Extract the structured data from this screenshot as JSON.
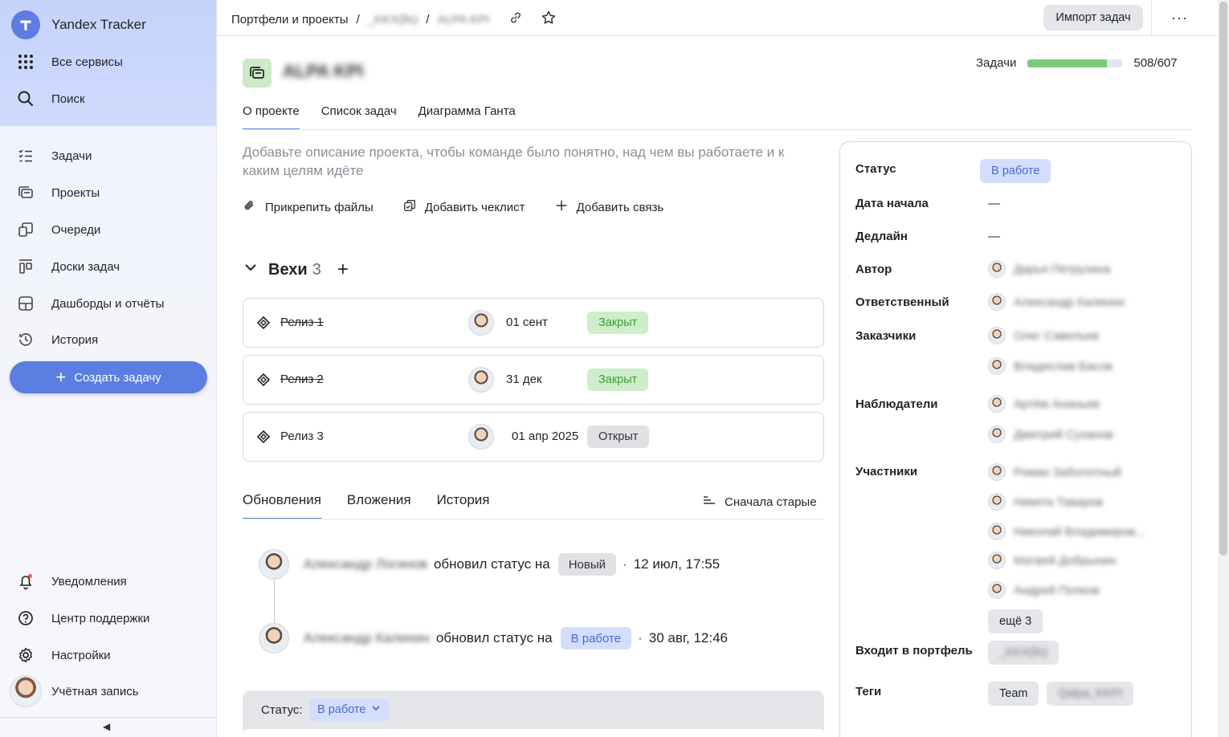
{
  "sidebar": {
    "app_name": "Yandex Tracker",
    "top_items": [
      {
        "label": "Все сервисы",
        "icon": "grid-icon"
      },
      {
        "label": "Поиск",
        "icon": "search-icon"
      }
    ],
    "nav_items": [
      {
        "label": "Задачи",
        "icon": "tasks-list-icon"
      },
      {
        "label": "Проекты",
        "icon": "projects-icon"
      },
      {
        "label": "Очереди",
        "icon": "queues-icon"
      },
      {
        "label": "Доски задач",
        "icon": "boards-icon"
      },
      {
        "label": "Дашборды и отчёты",
        "icon": "dashboard-icon"
      },
      {
        "label": "История",
        "icon": "history-icon"
      }
    ],
    "create_label": "Создать задачу",
    "bottom_items": [
      {
        "label": "Уведомления",
        "icon": "bell-icon"
      },
      {
        "label": "Центр поддержки",
        "icon": "help-icon"
      },
      {
        "label": "Настройки",
        "icon": "gear-icon"
      },
      {
        "label": "Учётная запись",
        "icon": "avatar"
      }
    ],
    "collapse_glyph": "◀"
  },
  "topbar": {
    "breadcrumb_root": "Портфели и проекты",
    "breadcrumb_sep": "/",
    "breadcrumb_portfolio": "_KKX(lls)",
    "breadcrumb_project": "ALPA KPI",
    "import_label": "Импорт задач",
    "more_glyph": "···"
  },
  "project": {
    "name": "ALPA KPI",
    "tasks_label": "Задачи",
    "tasks_done": 508,
    "tasks_total": 607,
    "tasks_text": "508/607",
    "tabs": [
      "О проекте",
      "Список задач",
      "Диаграмма Ганта"
    ],
    "description_placeholder": "Добавьте описание проекта, чтобы команде было понятно, над чем вы работаете и к каким целям идёте",
    "actions": [
      "Прикрепить файлы",
      "Добавить чеклист",
      "Добавить связь"
    ]
  },
  "milestones": {
    "title": "Вехи",
    "count": "3",
    "add_glyph": "+",
    "items": [
      {
        "name": "Релиз 1",
        "date": "01 сент",
        "status": "Закрыт",
        "struck": true
      },
      {
        "name": "Релиз 2",
        "date": "31 дек",
        "status": "Закрыт",
        "struck": true
      },
      {
        "name": "Релиз 3",
        "date": "01 апр 2025",
        "status": "Открыт",
        "struck": false
      }
    ]
  },
  "updates": {
    "tabs": [
      "Обновления",
      "Вложения",
      "История"
    ],
    "sort_label": "Сначала старые",
    "entries": [
      {
        "author": "Александр Логинов",
        "action": "обновил статус на",
        "status": "Новый",
        "time": "12 июл, 17:55"
      },
      {
        "author": "Александр Калинин",
        "action": "обновил статус на",
        "status": "В работе",
        "time": "30 авг, 12:46"
      }
    ],
    "status_label": "Статус:",
    "status_value": "В работе"
  },
  "details": {
    "status_label": "Статус",
    "status_value": "В работе",
    "start_label": "Дата начала",
    "start_value": "—",
    "deadline_label": "Дедлайн",
    "deadline_value": "—",
    "author_label": "Автор",
    "author_value": "Дарья Петрухина",
    "assignee_label": "Ответственный",
    "assignee_value": "Александр Калинин",
    "customers_label": "Заказчики",
    "customers": [
      "Олег Савельев",
      "Владислав Басов"
    ],
    "watchers_label": "Наблюдатели",
    "watchers": [
      "Артём Ананьев",
      "Дмитрий Суханов"
    ],
    "members_label": "Участники",
    "members": [
      "Роман Заболотный",
      "Никита Таваров",
      "Николай Владимиров...",
      "Матвей Добрынин",
      "Андрей Попков"
    ],
    "more_members": "ещё 3",
    "portfolio_label": "Входит в портфель",
    "portfolio_value": "_KKX(lls)",
    "tags_label": "Теги",
    "tags": [
      "Team",
      "Qalpa_KKPI"
    ]
  },
  "colors": {
    "accent": "#5b7fe0",
    "closed_bg": "#cdeec8",
    "closed_text": "#3e9b3a",
    "work_bg": "#d3defc",
    "progress": "#7ec97a"
  }
}
